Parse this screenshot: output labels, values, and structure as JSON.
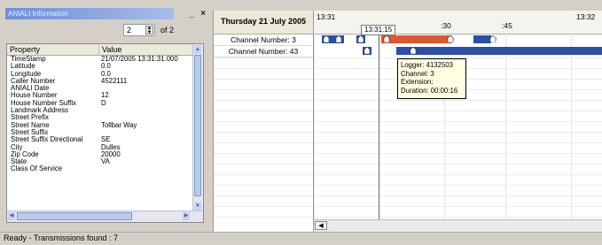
{
  "panel": {
    "title": "ANIALI Information",
    "minimize": "_",
    "close": "×",
    "page_value": "2",
    "page_of": "of 2"
  },
  "table": {
    "headers": [
      "Property",
      "Value"
    ],
    "rows": [
      {
        "key": "TimeStamp",
        "value": "21/07/2005 13:31:31.000"
      },
      {
        "key": "Latitude",
        "value": "0.0"
      },
      {
        "key": "Longitude",
        "value": "0.0"
      },
      {
        "key": "Caller Number",
        "value": "4522111"
      },
      {
        "key": "ANIALI Date",
        "value": ""
      },
      {
        "key": "House Number",
        "value": "12"
      },
      {
        "key": "House Number Suffix",
        "value": "D"
      },
      {
        "key": "Landmark Address",
        "value": ""
      },
      {
        "key": "Street Prefix",
        "value": ""
      },
      {
        "key": "Street Name",
        "value": "Tollbar Way"
      },
      {
        "key": "Street Suffix",
        "value": ""
      },
      {
        "key": "Street Suffix Directional",
        "value": "SE"
      },
      {
        "key": "City",
        "value": "Dulles"
      },
      {
        "key": "Zip Code",
        "value": "20000"
      },
      {
        "key": "State",
        "value": "VA"
      },
      {
        "key": "Class Of Service",
        "value": ""
      }
    ]
  },
  "timeline": {
    "date": "Thursday 21 July 2005",
    "ticks": [
      "13:31",
      ":30",
      ":45",
      "13:32"
    ],
    "cursor_time": "13:31:15",
    "channels": [
      "Channel Number: 3",
      "Channel Number: 43"
    ],
    "tooltip": {
      "logger": "Logger: 4132503",
      "channel": "Channel: 3",
      "extension": "Extension:",
      "duration": "Duration: 00:00:16"
    },
    "colors": {
      "blue": "#2b4ea8",
      "red": "#e0572f"
    }
  },
  "status": {
    "text": "Ready - Transmissions found : 7"
  }
}
